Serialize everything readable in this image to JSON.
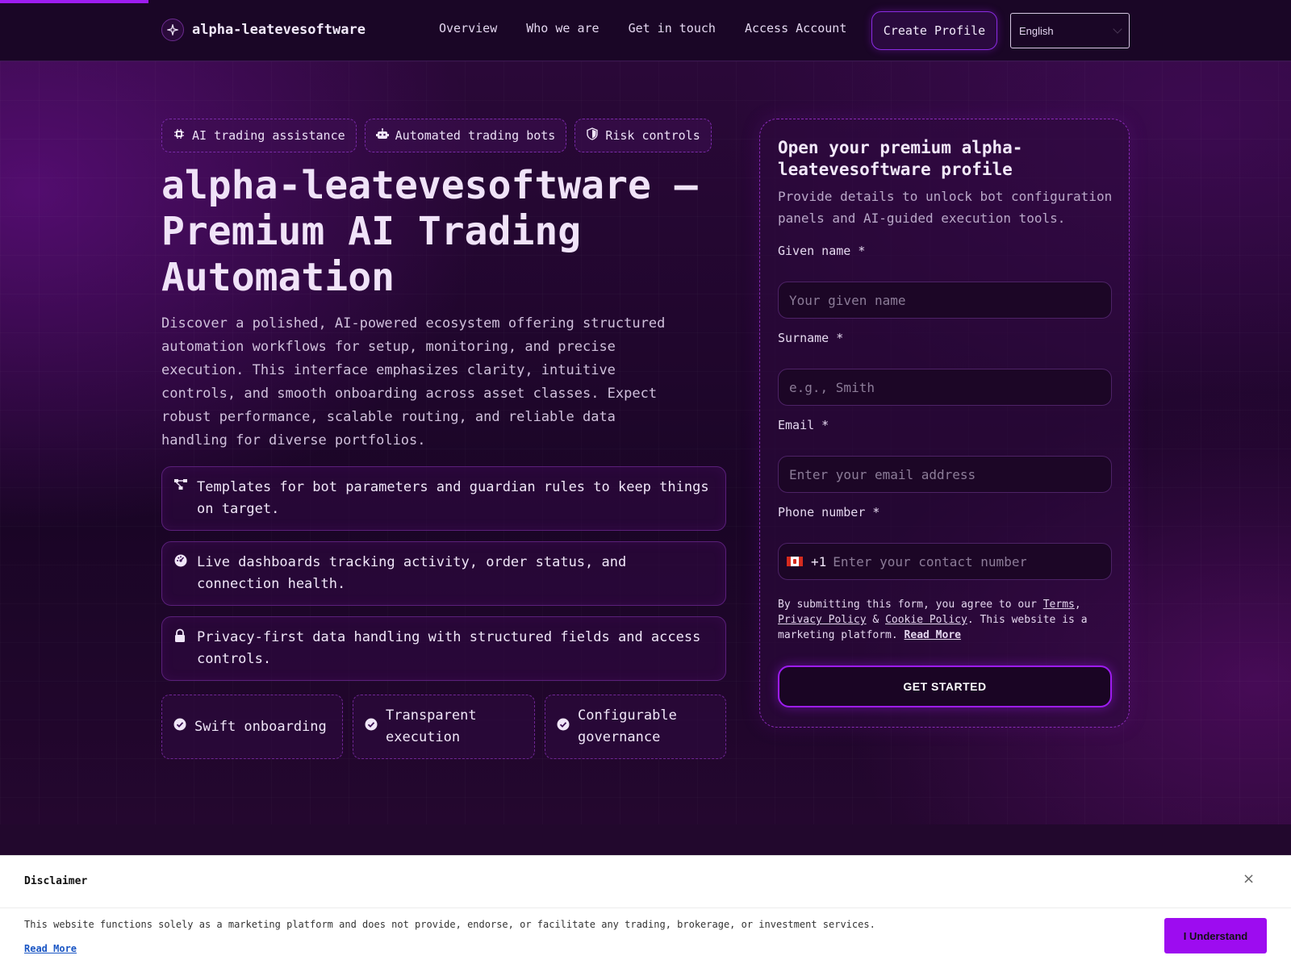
{
  "header": {
    "brand": "alpha-leatevesoftware",
    "nav": [
      "Overview",
      "Who we are",
      "Get in touch",
      "Access Account"
    ],
    "create_profile": "Create Profile",
    "language": "English"
  },
  "hero": {
    "chips": [
      {
        "label": "AI trading assistance",
        "icon": "chip-icon"
      },
      {
        "label": "Automated trading bots",
        "icon": "robot-icon"
      },
      {
        "label": "Risk controls",
        "icon": "shield-icon"
      }
    ],
    "title": "alpha-leatevesoftware — Premium AI Trading Automation",
    "description": "Discover a polished, AI-powered ecosystem offering structured automation workflows for setup, monitoring, and precise execution. This interface emphasizes clarity, intuitive controls, and smooth onboarding across asset classes. Expect robust performance, scalable routing, and reliable data handling for diverse portfolios.",
    "features": [
      {
        "text": "Templates for bot parameters and guardian rules to keep things on target.",
        "icon": "workflow-icon"
      },
      {
        "text": "Live dashboards tracking activity, order status, and connection health.",
        "icon": "gauge-icon"
      },
      {
        "text": "Privacy-first data handling with structured fields and access controls.",
        "icon": "lock-icon"
      }
    ],
    "pills": [
      "Swift onboarding",
      "Transparent execution",
      "Configurable governance"
    ]
  },
  "form": {
    "title": "Open your premium alpha-leatevesoftware profile",
    "subtitle": "Provide details to unlock bot configuration panels and AI-guided execution tools.",
    "given_name_label": "Given name *",
    "given_name_placeholder": "Your given name",
    "surname_label": "Surname *",
    "surname_placeholder": "e.g., Smith",
    "email_label": "Email *",
    "email_placeholder": "Enter your email address",
    "phone_label": "Phone number *",
    "phone_code": "+1",
    "phone_placeholder": "Enter your contact number",
    "consent_prefix": "By submitting this form, you agree to our ",
    "terms": "Terms",
    "comma": ",",
    "privacy": "Privacy Policy",
    "amp": " & ",
    "cookie": "Cookie Policy",
    "consent_suffix": ". This website is a marketing platform. ",
    "read_more": "Read More",
    "submit": "GET STARTED"
  },
  "disclaimer": {
    "title": "Disclaimer",
    "close": "×",
    "text": "This website functions solely as a marketing platform and does not provide, endorse, or facilitate any trading, brokerage, or investment services.",
    "read_more": "Read More",
    "button": "I Understand"
  },
  "colors": {
    "accent": "#9d1cf0",
    "background": "#1c0628",
    "disclaimer_button": "#9d0cf0"
  }
}
